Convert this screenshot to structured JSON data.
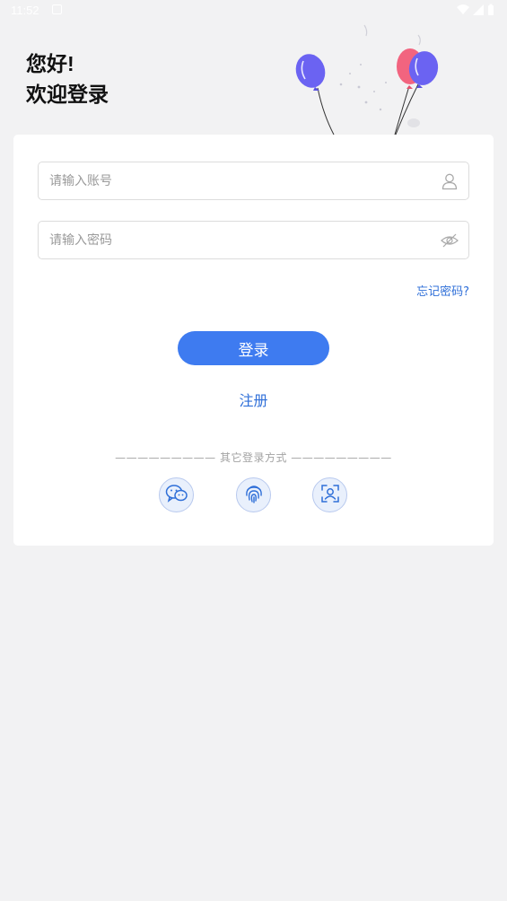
{
  "status_bar": {
    "time": "11:52",
    "notification_icon": "download-notification-icon",
    "right_icons": [
      "wifi-icon",
      "cellular-signal-icon",
      "battery-icon"
    ]
  },
  "header": {
    "line1": "您好!",
    "line2": "欢迎登录"
  },
  "login_form": {
    "account_placeholder": "请输入账号",
    "account_value": "",
    "account_icon": "user-icon",
    "password_placeholder": "请输入密码",
    "password_value": "",
    "password_icon": "eye-hidden-icon",
    "forgot_password": "忘记密码?",
    "login_button": "登录",
    "register_link": "注册"
  },
  "other_login": {
    "title": "————————— 其它登录方式 —————————",
    "methods": [
      {
        "name": "wechat",
        "icon": "wechat-icon"
      },
      {
        "name": "fingerprint",
        "icon": "fingerprint-icon"
      },
      {
        "name": "face",
        "icon": "face-recognition-icon"
      }
    ]
  },
  "colors": {
    "primary": "#3e7bf0",
    "link": "#2f6fd8",
    "background": "#f2f2f3",
    "balloon_purple": "#6b63f2",
    "balloon_pink": "#f2647f"
  }
}
